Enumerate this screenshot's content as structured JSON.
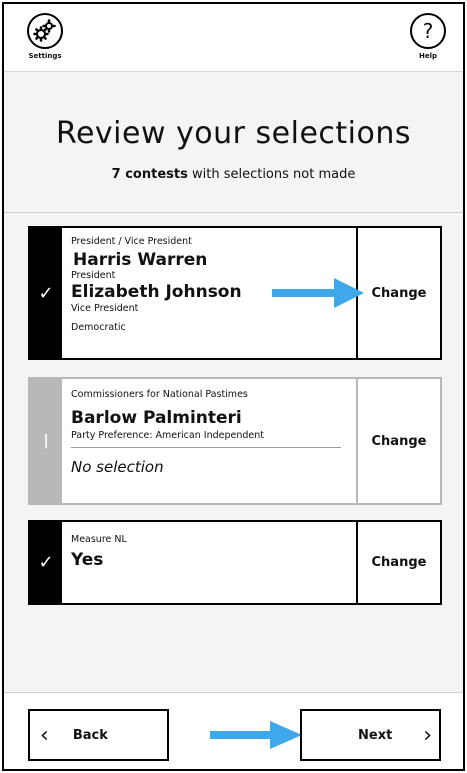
{
  "toolbar": {
    "settings_label": "Settings",
    "help_label": "Help",
    "help_glyph": "?"
  },
  "header": {
    "title": "Review your selections",
    "count_bold": "7 contests",
    "count_rest": "with selections not made"
  },
  "contests": [
    {
      "title": "President / Vice President",
      "status": "complete",
      "candidate1": "Harris Warren",
      "role1": "President",
      "candidate2": "Elizabeth Johnson",
      "role2": "Vice President",
      "party": "Democratic",
      "change_label": "Change"
    },
    {
      "title": "Commissioners for National Pastimes",
      "status": "incomplete",
      "candidate": "Barlow Palminteri",
      "party": "Party Preference: American Independent",
      "empty_label": "No selection",
      "change_label": "Change"
    },
    {
      "title": "Measure NL",
      "status": "complete",
      "answer": "Yes",
      "change_label": "Change"
    }
  ],
  "footer": {
    "back_label": "Back",
    "next_label": "Next"
  },
  "icons": {
    "settings": "gear-icon",
    "help": "question-icon",
    "check": "check-icon",
    "pending": "bar-icon",
    "arrow": "arrow-right-icon"
  },
  "colors": {
    "accent_arrow": "#3ea8ea",
    "complete": "#000000",
    "pending": "#b8b8b8"
  }
}
